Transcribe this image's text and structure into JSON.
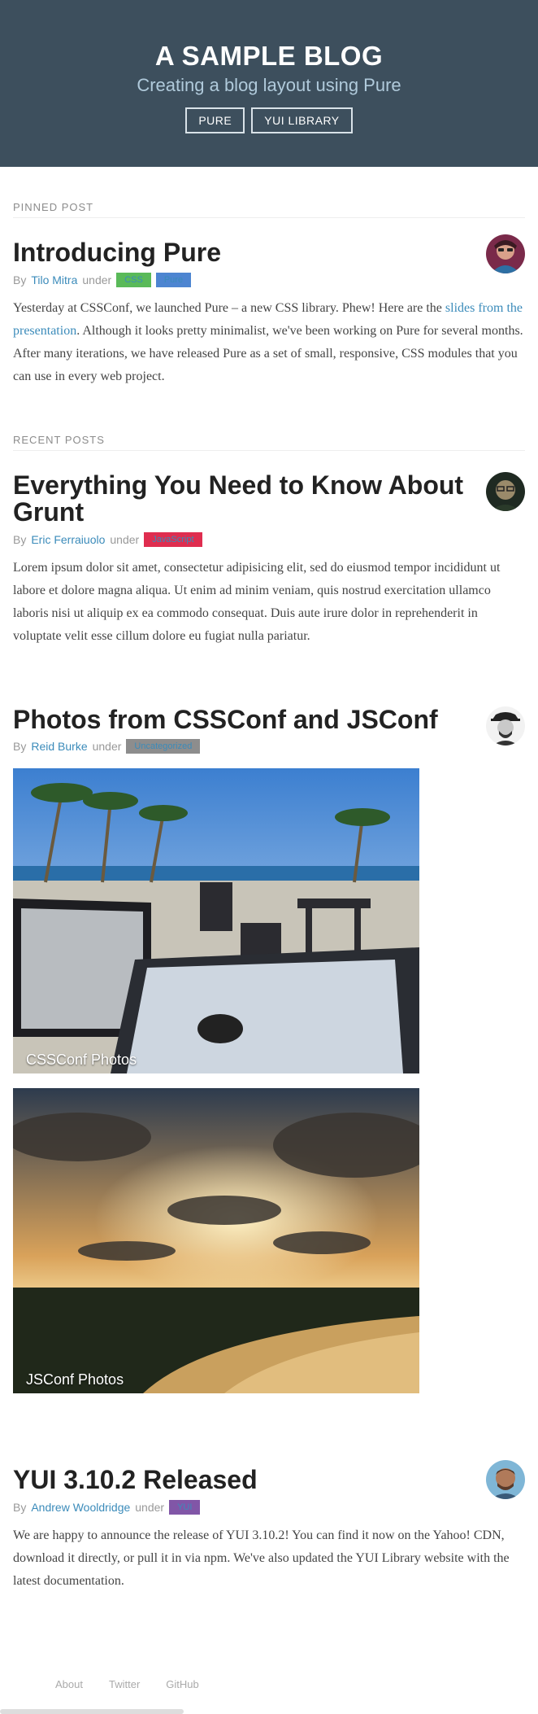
{
  "header": {
    "title": "A SAMPLE BLOG",
    "tagline": "Creating a blog layout using Pure",
    "nav": [
      {
        "label": "PURE"
      },
      {
        "label": "YUI LIBRARY"
      }
    ]
  },
  "pinned": {
    "heading": "PINNED POST",
    "post": {
      "title": "Introducing Pure",
      "by": "By",
      "author": "Tilo Mitra",
      "under": "under",
      "tags": [
        {
          "label": "CSS",
          "color": "#5aba59"
        },
        {
          "label": "Pure",
          "color": "#4d85d1"
        }
      ],
      "body_pre": "Yesterday at CSSConf, we launched Pure – a new CSS library. Phew! Here are the ",
      "body_link": "slides from the presentation",
      "body_post": ". Although it looks pretty minimalist, we've been working on Pure for several months. After many iterations, we have released Pure as a set of small, responsive, CSS modules that you can use in every web project."
    }
  },
  "recent": {
    "heading": "RECENT POSTS",
    "posts": [
      {
        "title": "Everything You Need to Know About Grunt",
        "by": "By",
        "author": "Eric Ferraiuolo",
        "under": "under",
        "tag": {
          "label": "JavaScript",
          "color": "#df2d4f"
        },
        "body": "Lorem ipsum dolor sit amet, consectetur adipisicing elit, sed do eiusmod tempor incididunt ut labore et dolore magna aliqua. Ut enim ad minim veniam, quis nostrud exercitation ullamco laboris nisi ut aliquip ex ea commodo consequat. Duis aute irure dolor in reprehenderit in voluptate velit esse cillum dolore eu fugiat nulla pariatur."
      },
      {
        "title": "Photos from CSSConf and JSConf",
        "by": "By",
        "author": "Reid Burke",
        "under": "under",
        "tag": {
          "label": "Uncategorized",
          "color": "#8d8d8d"
        },
        "photos": [
          {
            "caption": "CSSConf Photos"
          },
          {
            "caption": "JSConf Photos"
          }
        ]
      },
      {
        "title": "YUI 3.10.2 Released",
        "by": "By",
        "author": "Andrew Wooldridge",
        "under": "under",
        "tag": {
          "label": "YUI",
          "color": "#8156a7"
        },
        "body": "We are happy to announce the release of YUI 3.10.2! You can find it now on the Yahoo! CDN, download it directly, or pull it in via npm. We've also updated the YUI Library website with the latest documentation."
      }
    ]
  },
  "footer": {
    "links": [
      {
        "label": "About"
      },
      {
        "label": "Twitter"
      },
      {
        "label": "GitHub"
      }
    ]
  }
}
